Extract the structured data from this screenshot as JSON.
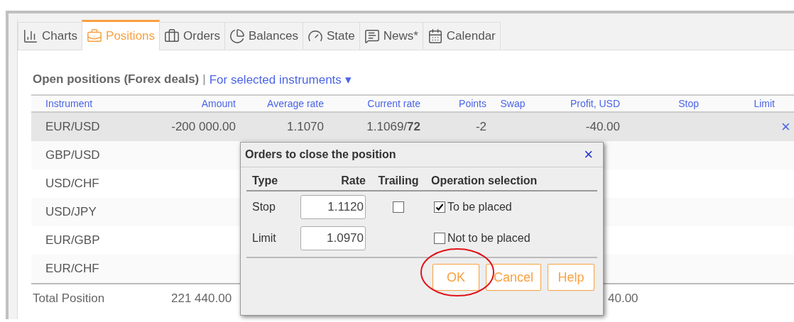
{
  "tabs": [
    {
      "label": "Charts",
      "selected": false
    },
    {
      "label": "Positions",
      "selected": true
    },
    {
      "label": "Orders",
      "selected": false
    },
    {
      "label": "Balances",
      "selected": false
    },
    {
      "label": "State",
      "selected": false
    },
    {
      "label": "News*",
      "selected": false
    },
    {
      "label": "Calendar",
      "selected": false
    }
  ],
  "heading": {
    "title": "Open positions (Forex deals)",
    "separator": "|",
    "filter": "For selected instruments",
    "filter_caret": "▾"
  },
  "table": {
    "columns": [
      "Instrument",
      "Amount",
      "Average rate",
      "Current rate",
      "Points",
      "Swap",
      "Profit, USD",
      "Stop",
      "Limit"
    ],
    "rows": [
      {
        "instrument": "EUR/USD",
        "amount": "-200 000.00",
        "average_rate": "1.1070",
        "current_rate": "1.1069/**72**",
        "points": "-2",
        "profit": "-40.00",
        "close": "×",
        "selected": true
      },
      {
        "instrument": "GBP/USD",
        "selected": false
      },
      {
        "instrument": "USD/CHF",
        "selected": false
      },
      {
        "instrument": "USD/JPY",
        "selected": false
      },
      {
        "instrument": "EUR/GBP",
        "selected": false
      },
      {
        "instrument": "EUR/CHF",
        "selected": false
      }
    ],
    "total": {
      "label": "Total Position",
      "amount": "221 440.00",
      "profit": "40.00"
    }
  },
  "dialog": {
    "title": "Orders to close the position",
    "close": "×",
    "columns": [
      "Type",
      "Rate",
      "Trailing",
      "Operation selection"
    ],
    "orders": [
      {
        "type": "Stop",
        "rate": "1.1120",
        "trailing": false
      },
      {
        "type": "Limit",
        "rate": "1.0970"
      }
    ],
    "options": [
      {
        "label": "To be placed",
        "checked": true
      },
      {
        "label": "Not to be placed",
        "checked": false
      }
    ],
    "buttons": [
      "OK",
      "Cancel",
      "Help"
    ]
  }
}
